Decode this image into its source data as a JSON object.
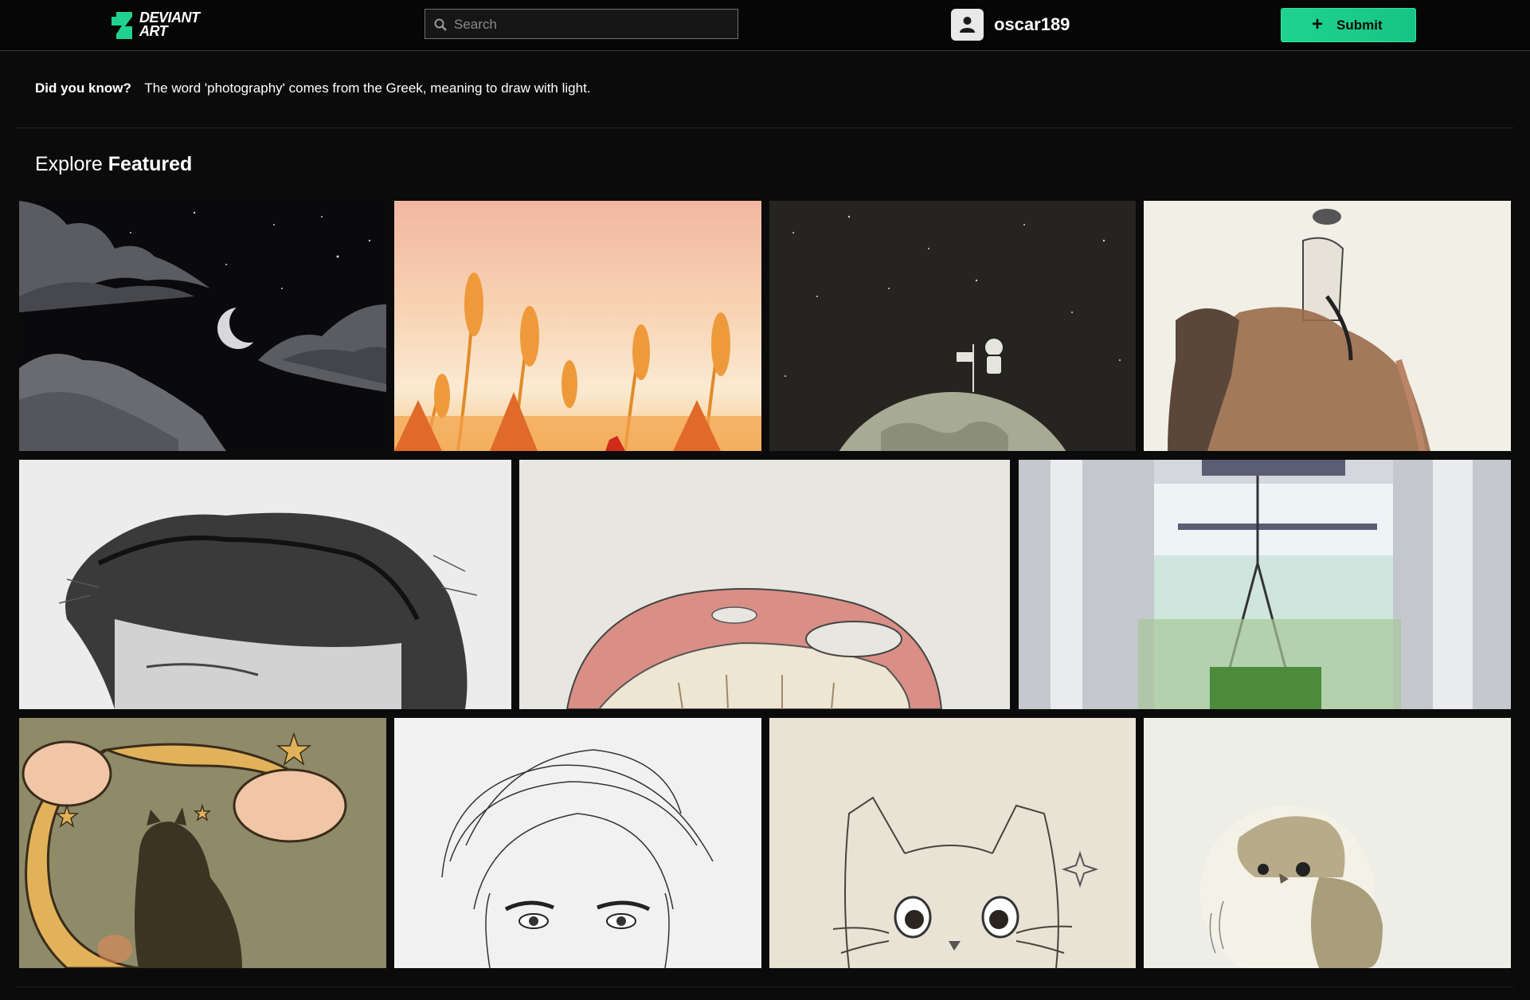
{
  "header": {
    "logo_text": "DEVIANT ART",
    "search_placeholder": "Search",
    "username": "oscar189",
    "submit_label": "Submit"
  },
  "did_you_know": {
    "label": "Did you know?",
    "text": "The word 'photography' comes from the Greek, meaning to draw with light."
  },
  "explore": {
    "prefix": "Explore",
    "title": "Featured"
  },
  "colors": {
    "accent": "#1fd38e",
    "background": "#0b0b0b"
  },
  "icons": [
    "deviantart-logo-icon",
    "search-icon",
    "user-icon",
    "plus-icon"
  ]
}
